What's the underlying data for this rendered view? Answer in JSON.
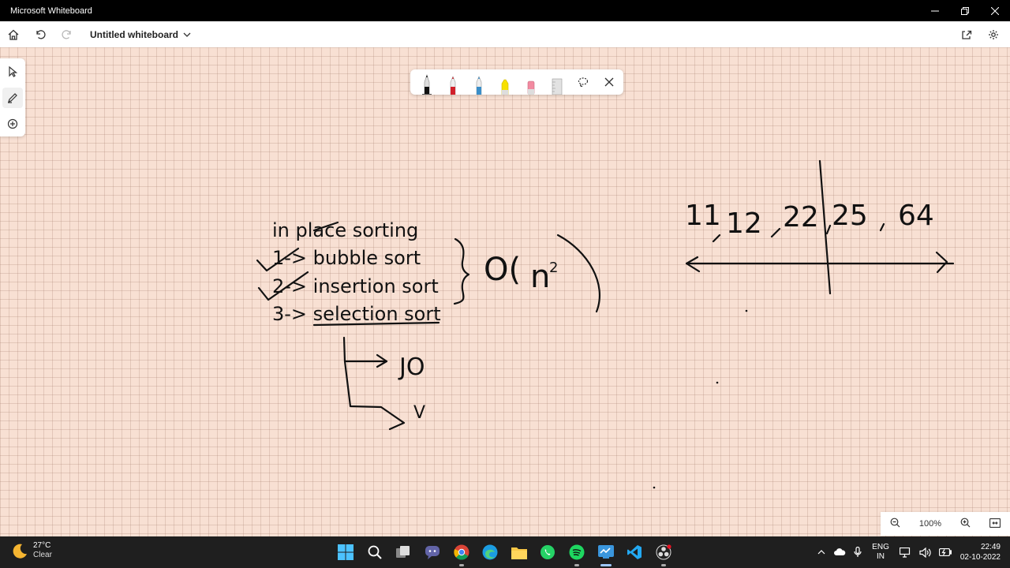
{
  "window": {
    "title": "Microsoft Whiteboard"
  },
  "appbar": {
    "doc_title": "Untitled whiteboard"
  },
  "canvas": {
    "notes": {
      "heading": "in place sorting",
      "item1": "1-> bubble sort",
      "item2": "2-> insertion sort",
      "item3": "3-> selection sort",
      "complexity_o": "O(",
      "complexity_n": "n",
      "complexity_exp": "2",
      "branch_jo": "JO",
      "branch_v": "V",
      "numbers": [
        "11",
        "12",
        "22",
        "25",
        "64"
      ]
    }
  },
  "ink_toolbar": {
    "pens": [
      {
        "name": "black-pen",
        "color": "#111111"
      },
      {
        "name": "red-pen",
        "color": "#d1202a"
      },
      {
        "name": "blue-pen",
        "color": "#3a8ec8"
      },
      {
        "name": "highlighter",
        "color": "#f7e000"
      },
      {
        "name": "eraser",
        "color": "#f28aa0"
      },
      {
        "name": "ruler",
        "color": "#bcbcbc"
      }
    ]
  },
  "zoom": {
    "level": "100%"
  },
  "taskbar": {
    "weather_temp": "27°C",
    "weather_cond": "Clear",
    "lang_line1": "ENG",
    "lang_line2": "IN",
    "time": "22:49",
    "date": "02-10-2022"
  }
}
